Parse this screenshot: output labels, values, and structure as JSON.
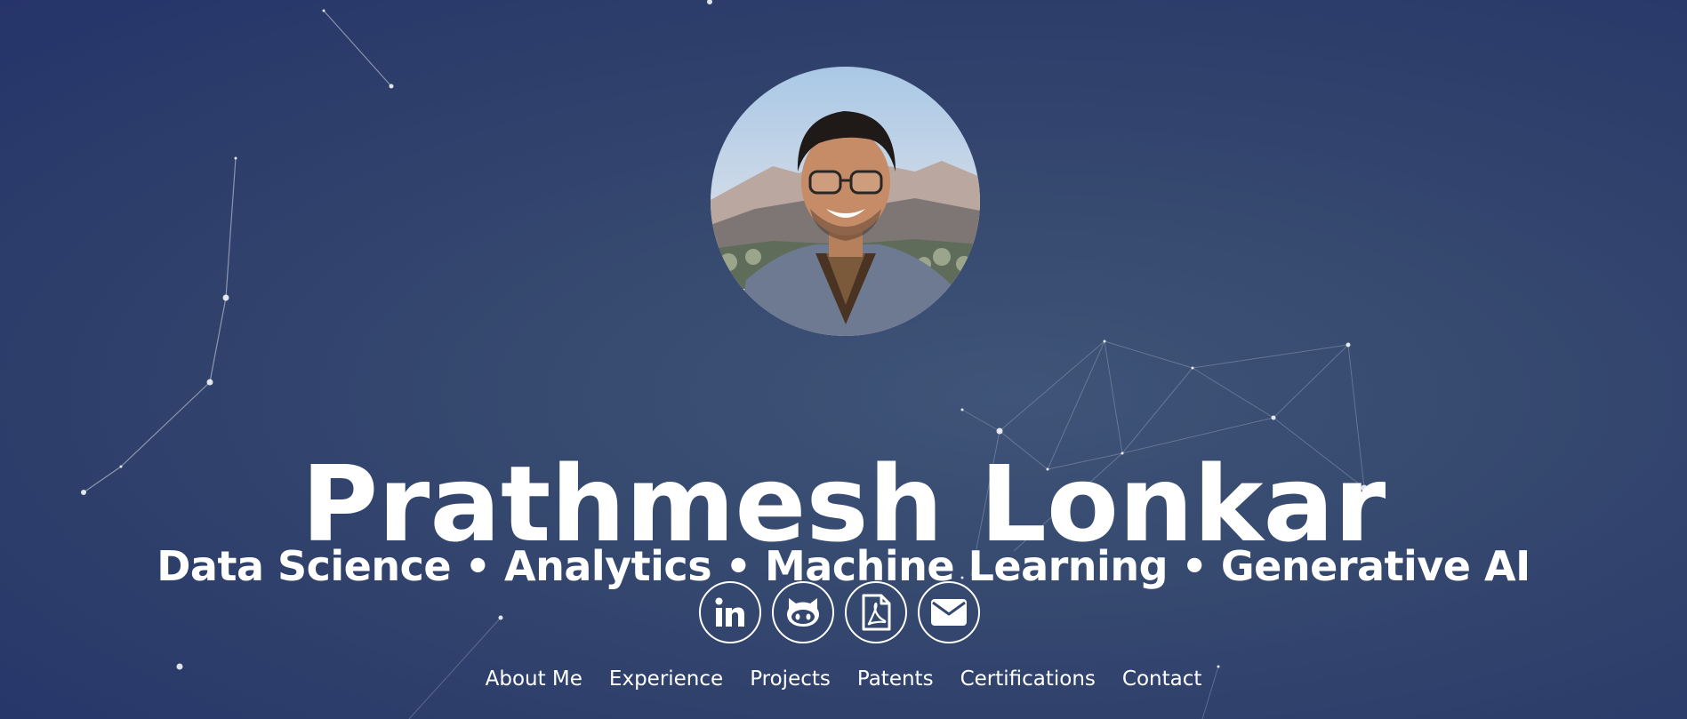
{
  "profile": {
    "name": "Prathmesh Lonkar",
    "tagline": "Data Science • Analytics • Machine Learning • Generative AI",
    "photo_icon": "profile-photo"
  },
  "socials": [
    {
      "icon": "linkedin-icon"
    },
    {
      "icon": "github-icon"
    },
    {
      "icon": "pdf-resume-icon"
    },
    {
      "icon": "email-icon"
    }
  ],
  "nav": {
    "items": [
      {
        "label": "About Me"
      },
      {
        "label": "Experience"
      },
      {
        "label": "Projects"
      },
      {
        "label": "Patents"
      },
      {
        "label": "Certifications"
      },
      {
        "label": "Contact"
      }
    ]
  },
  "colors": {
    "background_center": "#3f5478",
    "background_edge": "#25346a",
    "text": "#ffffff"
  }
}
